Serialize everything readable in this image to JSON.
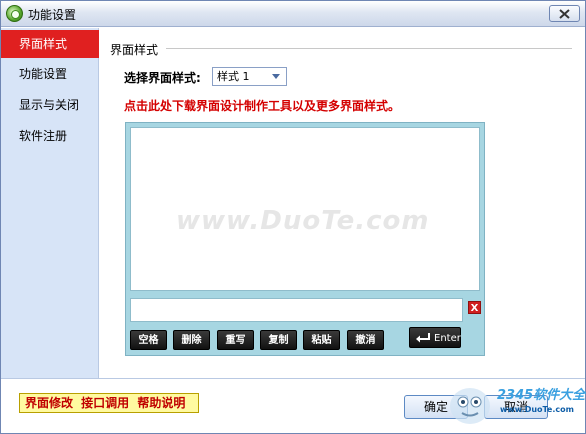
{
  "window": {
    "title": "功能设置"
  },
  "sidebar": {
    "items": [
      {
        "label": "界面样式",
        "active": true
      },
      {
        "label": "功能设置",
        "active": false
      },
      {
        "label": "显示与关闭",
        "active": false
      },
      {
        "label": "软件注册",
        "active": false
      }
    ]
  },
  "content": {
    "group_title": "界面样式",
    "style_select": {
      "label": "选择界面样式:",
      "value": "样式 1"
    },
    "download_link": "点击此处下载界面设计制作工具以及更多界面样式。",
    "preview": {
      "watermark": "www.DuoTe.com",
      "keys": [
        "空格",
        "删除",
        "重写",
        "复制",
        "粘贴",
        "撤消"
      ],
      "enter_label": "Enter",
      "clear_label": "X"
    }
  },
  "footer": {
    "links": "界面修改 接口调用 帮助说明",
    "ok_label": "确定",
    "cancel_label": "取消",
    "logo_text": "2345软件大全",
    "logo_url": "www.DuoTe.com"
  },
  "colors": {
    "accent": "#e02020",
    "sidebar_bg": "#d7e4f7",
    "link_red": "#d40000",
    "preview_bg": "#a7d6e2"
  }
}
